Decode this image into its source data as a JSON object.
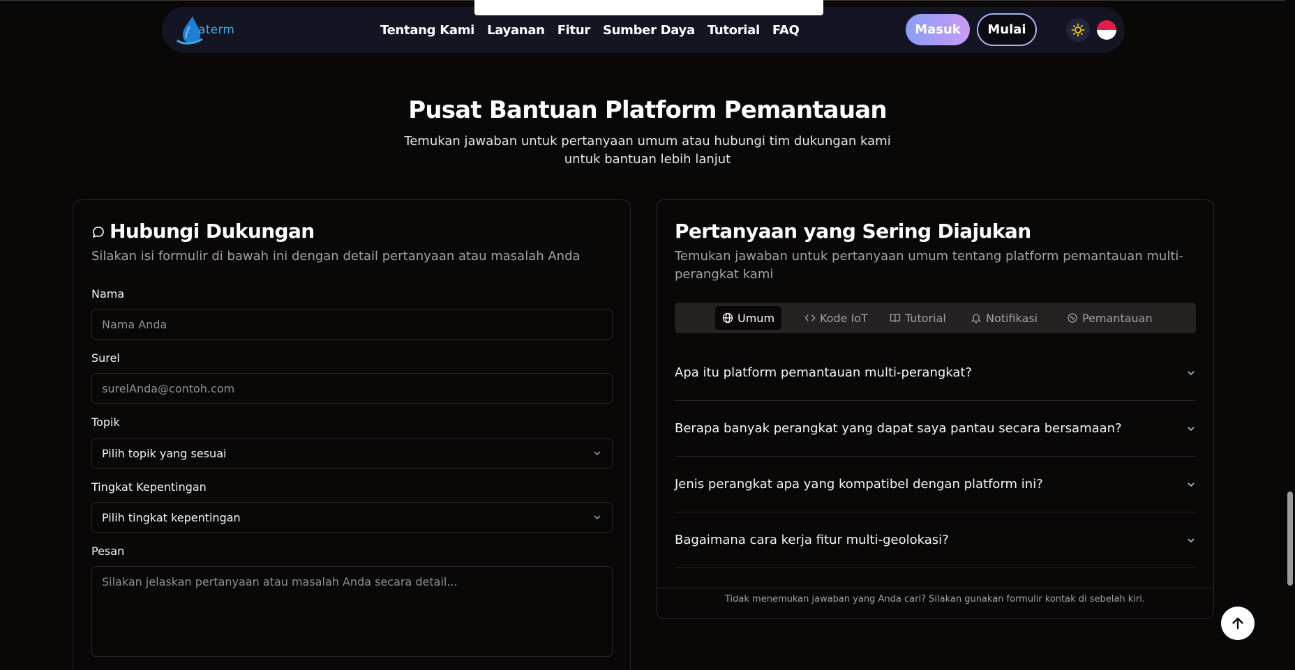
{
  "nav": {
    "logo_text": "aterm",
    "links": [
      "Tentang Kami",
      "Layanan",
      "Fitur",
      "Sumber Daya",
      "Tutorial",
      "FAQ"
    ],
    "login_label": "Masuk",
    "start_label": "Mulai",
    "theme_icon": "sun-icon",
    "language_icon": "indonesia-flag-icon"
  },
  "hero": {
    "title": "Pusat Bantuan Platform Pemantauan",
    "subtitle_line1": "Temukan jawaban untuk pertanyaan umum atau hubungi tim dukungan kami",
    "subtitle_line2": "untuk bantuan lebih lanjut"
  },
  "contact": {
    "title": "Hubungi Dukungan",
    "description": "Silakan isi formulir di bawah ini dengan detail pertanyaan atau masalah Anda",
    "name_label": "Nama",
    "name_placeholder": "Nama Anda",
    "email_label": "Surel",
    "email_placeholder": "surelAnda@contoh.com",
    "topic_label": "Topik",
    "topic_value": "Pilih topik yang sesuai",
    "priority_label": "Tingkat Kepentingan",
    "priority_value": "Pilih tingkat kepentingan",
    "message_label": "Pesan",
    "message_placeholder": "Silakan jelaskan pertanyaan atau masalah Anda secara detail..."
  },
  "faq": {
    "title": "Pertanyaan yang Sering Diajukan",
    "description_line1": "Temukan jawaban untuk pertanyaan umum tentang platform pemantauan multi-",
    "description_line2": "perangkat kami",
    "tabs": [
      "Umum",
      "Kode IoT",
      "Tutorial",
      "Notifikasi",
      "Pemantauan"
    ],
    "active_tab": "Umum",
    "questions": [
      "Apa itu platform pemantauan multi-perangkat?",
      "Berapa banyak perangkat yang dapat saya pantau secara bersamaan?",
      "Jenis perangkat apa yang kompatibel dengan platform ini?",
      "Bagaimana cara kerja fitur multi-geolokasi?"
    ],
    "footer_note": "Tidak menemukan jawaban yang Anda cari? Silakan gunakan formulir kontak di sebelah kiri."
  },
  "colors": {
    "background": "#0a0707",
    "navbar": "#141522",
    "accent_gradient_start": "#8b9cf7",
    "accent_gradient_end": "#c89bf5",
    "logo_blue": "#3fa9e6"
  }
}
